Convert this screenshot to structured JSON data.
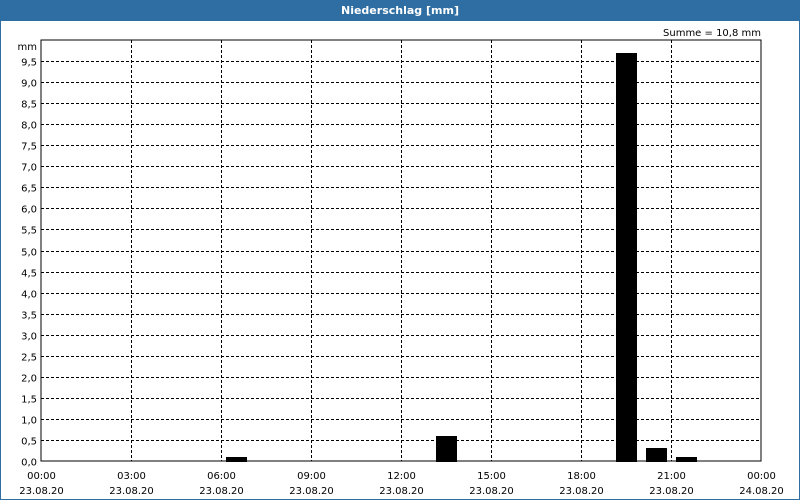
{
  "window": {
    "title": "Niederschlag [mm]"
  },
  "colors": {
    "titlebar": "#2f6ea3",
    "bars": "#000000",
    "grid": "#000000"
  },
  "chart_data": {
    "type": "bar",
    "title": "Niederschlag [mm]",
    "ylabel": "mm",
    "summary": "Summe = 10,8 mm",
    "ylim": [
      0,
      10
    ],
    "grid": true,
    "y_tick_values": [
      0,
      0.5,
      1,
      1.5,
      2,
      2.5,
      3,
      3.5,
      4,
      4.5,
      5,
      5.5,
      6,
      6.5,
      7,
      7.5,
      8,
      8.5,
      9,
      9.5
    ],
    "y_tick_labels": [
      "0,0",
      "0,5",
      "1,0",
      "1,5",
      "2,0",
      "2,5",
      "3,0",
      "3,5",
      "4,0",
      "4,5",
      "5,0",
      "5,5",
      "6,0",
      "6,5",
      "7,0",
      "7,5",
      "8,0",
      "8,5",
      "9,0",
      "9,5"
    ],
    "x_ticks": [
      {
        "hour": 0,
        "time": "00:00",
        "date": "23.08.20"
      },
      {
        "hour": 3,
        "time": "03:00",
        "date": "23.08.20"
      },
      {
        "hour": 6,
        "time": "06:00",
        "date": "23.08.20"
      },
      {
        "hour": 9,
        "time": "09:00",
        "date": "23.08.20"
      },
      {
        "hour": 12,
        "time": "12:00",
        "date": "23.08.20"
      },
      {
        "hour": 15,
        "time": "15:00",
        "date": "23.08.20"
      },
      {
        "hour": 18,
        "time": "18:00",
        "date": "23.08.20"
      },
      {
        "hour": 21,
        "time": "21:00",
        "date": "23.08.20"
      },
      {
        "hour": 24,
        "time": "00:00",
        "date": "24.08.20"
      }
    ],
    "xlim_hours": [
      0,
      24
    ],
    "series": [
      {
        "values": [
          {
            "hour": 6,
            "value": 0.1
          },
          {
            "hour": 13,
            "value": 0.6
          },
          {
            "hour": 19,
            "value": 9.7
          },
          {
            "hour": 20,
            "value": 0.3
          },
          {
            "hour": 21,
            "value": 0.1
          }
        ]
      }
    ]
  }
}
